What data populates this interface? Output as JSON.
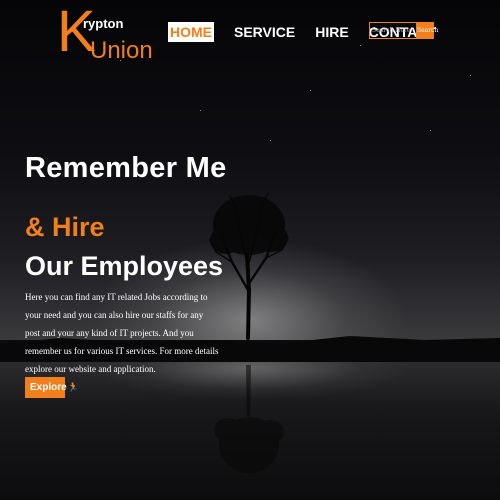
{
  "logo": {
    "letter": "K",
    "top_text": "rypton",
    "bottom_text": "Union"
  },
  "nav": {
    "items": [
      {
        "label": "HOME",
        "active": true
      },
      {
        "label": "SERVICE",
        "active": false
      },
      {
        "label": "HIRE",
        "active": false
      },
      {
        "label": "CONTACT",
        "active": false
      }
    ]
  },
  "search": {
    "placeholder": "Search Here",
    "button_label": "Search"
  },
  "hero": {
    "title": "Remember Me",
    "subtitle_accent": "& Hire",
    "subtitle_main": "Our Employees",
    "description": "Here you can find any IT related Jobs according to your need and you can also hire our staffs for any post and your any kind of IT projects. And you remember us for various IT services. For more details explore our website and application.",
    "cta_label": "Explore",
    "cta_icon": "running-person-icon"
  },
  "colors": {
    "accent": "#f07f1c",
    "text": "#ffffff",
    "background": "#0b0b0d"
  }
}
